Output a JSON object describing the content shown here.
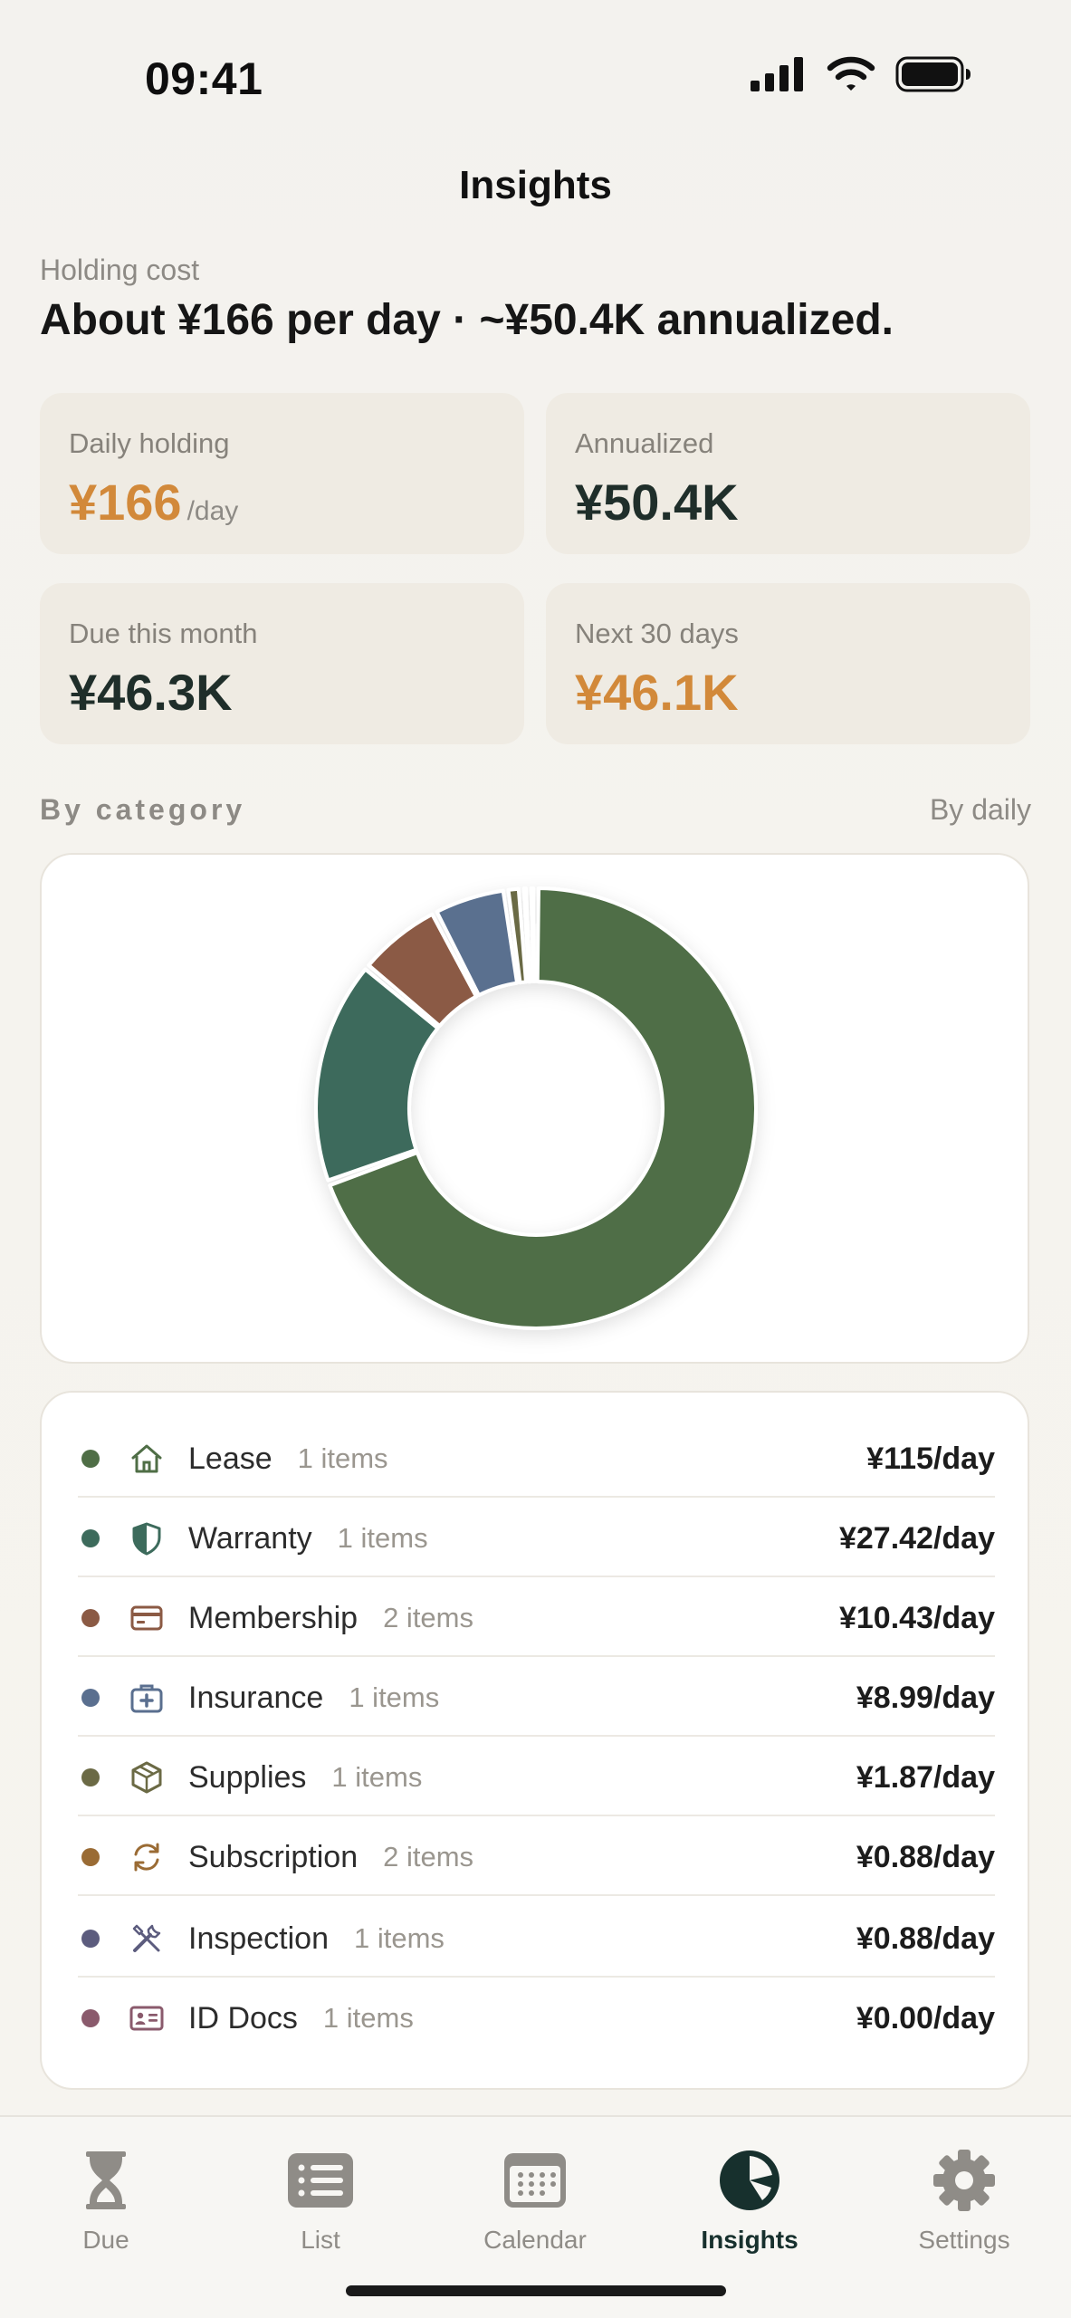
{
  "status_bar": {
    "time": "09:41"
  },
  "nav": {
    "title": "Insights"
  },
  "holding": {
    "label": "Holding cost",
    "summary": "About ¥166 per day · ~¥50.4K annualized."
  },
  "stats": [
    {
      "label": "Daily holding",
      "value": "¥166",
      "unit": "/day",
      "color": "#d2893a"
    },
    {
      "label": "Annualized",
      "value": "¥50.4K",
      "unit": "",
      "color": "#1f2e2a"
    },
    {
      "label": "Due this month",
      "value": "¥46.3K",
      "unit": "",
      "color": "#1f2e2a"
    },
    {
      "label": "Next 30 days",
      "value": "¥46.1K",
      "unit": "",
      "color": "#d2893a"
    }
  ],
  "section": {
    "title": "By category",
    "action": "By daily"
  },
  "categories": [
    {
      "name": "Lease",
      "count": "1 items",
      "amount": "¥115/day",
      "value": 115,
      "color": "#4f6e46",
      "icon": "house-icon"
    },
    {
      "name": "Warranty",
      "count": "1 items",
      "amount": "¥27.42/day",
      "value": 27.42,
      "color": "#3d6b5c",
      "icon": "shield-icon"
    },
    {
      "name": "Membership",
      "count": "2 items",
      "amount": "¥10.43/day",
      "value": 10.43,
      "color": "#8b5a44",
      "icon": "card-icon"
    },
    {
      "name": "Insurance",
      "count": "1 items",
      "amount": "¥8.99/day",
      "value": 8.99,
      "color": "#5a6f8f",
      "icon": "medkit-icon"
    },
    {
      "name": "Supplies",
      "count": "1 items",
      "amount": "¥1.87/day",
      "value": 1.87,
      "color": "#6b6a45",
      "icon": "box-icon"
    },
    {
      "name": "Subscription",
      "count": "2 items",
      "amount": "¥0.88/day",
      "value": 0.88,
      "color": "#9a6b34",
      "icon": "refresh-icon"
    },
    {
      "name": "Inspection",
      "count": "1 items",
      "amount": "¥0.88/day",
      "value": 0.88,
      "color": "#5c5c7e",
      "icon": "tools-icon"
    },
    {
      "name": "ID Docs",
      "count": "1 items",
      "amount": "¥0.00/day",
      "value": 0,
      "color": "#8a5a6c",
      "icon": "id-card-icon"
    }
  ],
  "tabs": [
    {
      "label": "Due",
      "icon": "hourglass-icon",
      "active": false
    },
    {
      "label": "List",
      "icon": "list-icon",
      "active": false
    },
    {
      "label": "Calendar",
      "icon": "calendar-icon",
      "active": false
    },
    {
      "label": "Insights",
      "icon": "pie-chart-icon",
      "active": true
    },
    {
      "label": "Settings",
      "icon": "gear-icon",
      "active": false
    }
  ]
}
